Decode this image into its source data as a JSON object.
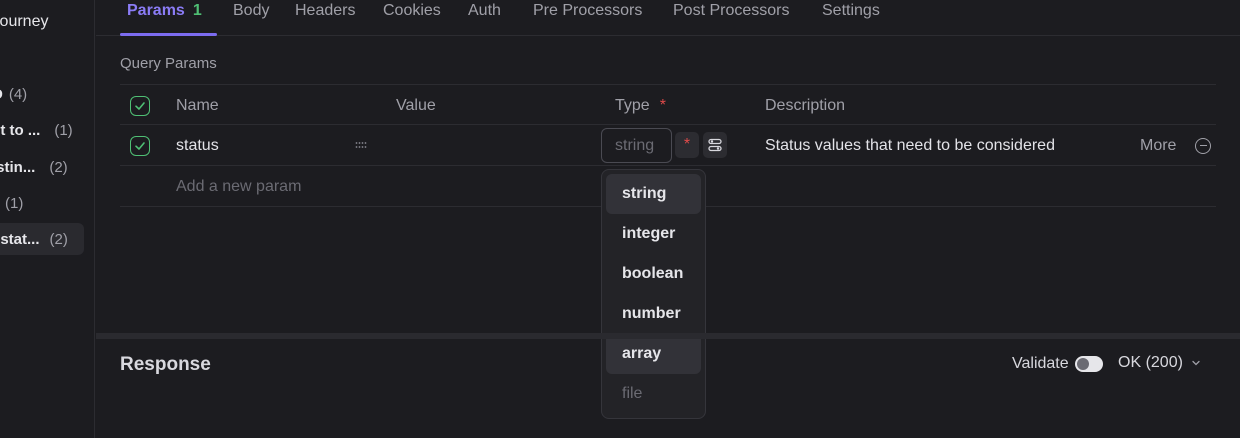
{
  "sidebar": {
    "title": "journey",
    "items": [
      {
        "label": "D",
        "count": "(4)"
      },
      {
        "label": "et to ...",
        "count": "(1)"
      },
      {
        "label": "istin...",
        "count": "(2)"
      },
      {
        "label": "",
        "count": "(1)"
      },
      {
        "label": "/ stat...",
        "count": "(2)"
      }
    ]
  },
  "tabs": [
    {
      "label": "Params",
      "badge": "1"
    },
    {
      "label": "Body"
    },
    {
      "label": "Headers"
    },
    {
      "label": "Cookies"
    },
    {
      "label": "Auth"
    },
    {
      "label": "Pre Processors"
    },
    {
      "label": "Post Processors"
    },
    {
      "label": "Settings"
    }
  ],
  "query_params": {
    "section_label": "Query Params",
    "headers": {
      "name": "Name",
      "value": "Value",
      "type": "Type",
      "required_mark": "*",
      "description": "Description"
    },
    "rows": [
      {
        "name": "status",
        "value": "",
        "type_placeholder": "string",
        "required_mark": "*",
        "description": "Status values that need to be considered",
        "more": "More"
      }
    ],
    "add_placeholder": "Add a new param"
  },
  "type_dropdown": {
    "options": [
      "string",
      "integer",
      "boolean",
      "number",
      "array",
      "file"
    ]
  },
  "response": {
    "title": "Response",
    "validate_label": "Validate",
    "status": "OK (200)"
  }
}
